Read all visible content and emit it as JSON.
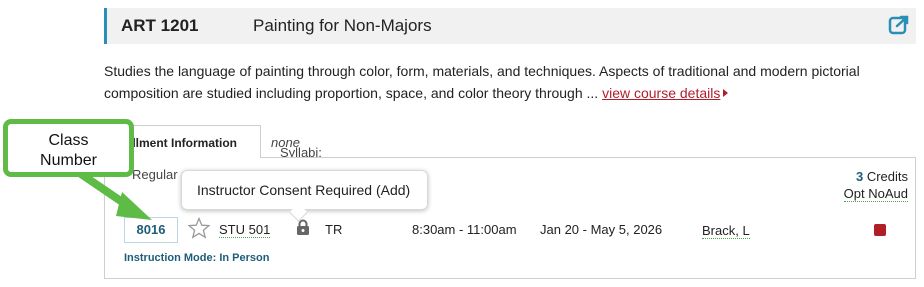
{
  "course": {
    "code": "ART 1201",
    "title": "Painting for Non-Majors",
    "description": "Studies the language of painting through color, form, materials, and techniques. Aspects of traditional and modern pictorial composition are studied including proportion, space, and color theory through ...",
    "details_link": "view course details"
  },
  "tabs": {
    "enrollment": "ollment Information",
    "syllabi_label": "Syllabi:",
    "syllabi_value": "none"
  },
  "section": {
    "type": "Regular",
    "credits_num": "3",
    "credits_label": "Credits",
    "grade_option": "Opt NoAud",
    "class_number": "8016",
    "room": "STU 501",
    "days": "TR",
    "time": "8:30am - 11:00am",
    "dates": "Jan 20 - May 5, 2026",
    "instructor": "Brack, L",
    "instruction_mode": "Instruction Mode: In Person"
  },
  "tooltip": {
    "text": "Instructor Consent Required (Add)"
  },
  "callout": {
    "line1": "Class",
    "line2": "Number"
  },
  "colors": {
    "accent": "#2a8fb4",
    "link": "#b01e2a",
    "callout": "#5dbb46",
    "status": "#b01e2a"
  },
  "icons": {
    "share": "share-icon",
    "star": "star-icon",
    "lock": "lock-icon"
  }
}
